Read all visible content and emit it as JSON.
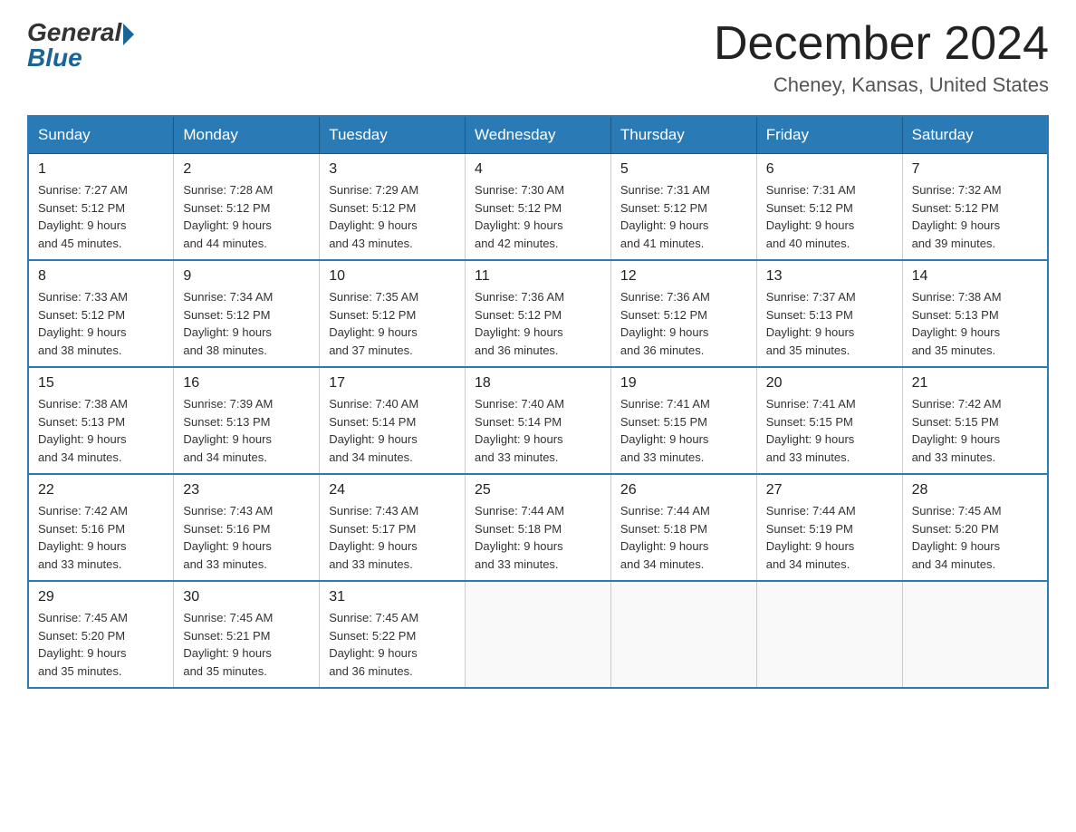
{
  "logo": {
    "general": "General",
    "blue": "Blue"
  },
  "title": {
    "month_year": "December 2024",
    "location": "Cheney, Kansas, United States"
  },
  "days_of_week": [
    "Sunday",
    "Monday",
    "Tuesday",
    "Wednesday",
    "Thursday",
    "Friday",
    "Saturday"
  ],
  "weeks": [
    [
      {
        "day": "1",
        "sunrise": "7:27 AM",
        "sunset": "5:12 PM",
        "daylight": "9 hours and 45 minutes."
      },
      {
        "day": "2",
        "sunrise": "7:28 AM",
        "sunset": "5:12 PM",
        "daylight": "9 hours and 44 minutes."
      },
      {
        "day": "3",
        "sunrise": "7:29 AM",
        "sunset": "5:12 PM",
        "daylight": "9 hours and 43 minutes."
      },
      {
        "day": "4",
        "sunrise": "7:30 AM",
        "sunset": "5:12 PM",
        "daylight": "9 hours and 42 minutes."
      },
      {
        "day": "5",
        "sunrise": "7:31 AM",
        "sunset": "5:12 PM",
        "daylight": "9 hours and 41 minutes."
      },
      {
        "day": "6",
        "sunrise": "7:31 AM",
        "sunset": "5:12 PM",
        "daylight": "9 hours and 40 minutes."
      },
      {
        "day": "7",
        "sunrise": "7:32 AM",
        "sunset": "5:12 PM",
        "daylight": "9 hours and 39 minutes."
      }
    ],
    [
      {
        "day": "8",
        "sunrise": "7:33 AM",
        "sunset": "5:12 PM",
        "daylight": "9 hours and 38 minutes."
      },
      {
        "day": "9",
        "sunrise": "7:34 AM",
        "sunset": "5:12 PM",
        "daylight": "9 hours and 38 minutes."
      },
      {
        "day": "10",
        "sunrise": "7:35 AM",
        "sunset": "5:12 PM",
        "daylight": "9 hours and 37 minutes."
      },
      {
        "day": "11",
        "sunrise": "7:36 AM",
        "sunset": "5:12 PM",
        "daylight": "9 hours and 36 minutes."
      },
      {
        "day": "12",
        "sunrise": "7:36 AM",
        "sunset": "5:12 PM",
        "daylight": "9 hours and 36 minutes."
      },
      {
        "day": "13",
        "sunrise": "7:37 AM",
        "sunset": "5:13 PM",
        "daylight": "9 hours and 35 minutes."
      },
      {
        "day": "14",
        "sunrise": "7:38 AM",
        "sunset": "5:13 PM",
        "daylight": "9 hours and 35 minutes."
      }
    ],
    [
      {
        "day": "15",
        "sunrise": "7:38 AM",
        "sunset": "5:13 PM",
        "daylight": "9 hours and 34 minutes."
      },
      {
        "day": "16",
        "sunrise": "7:39 AM",
        "sunset": "5:13 PM",
        "daylight": "9 hours and 34 minutes."
      },
      {
        "day": "17",
        "sunrise": "7:40 AM",
        "sunset": "5:14 PM",
        "daylight": "9 hours and 34 minutes."
      },
      {
        "day": "18",
        "sunrise": "7:40 AM",
        "sunset": "5:14 PM",
        "daylight": "9 hours and 33 minutes."
      },
      {
        "day": "19",
        "sunrise": "7:41 AM",
        "sunset": "5:15 PM",
        "daylight": "9 hours and 33 minutes."
      },
      {
        "day": "20",
        "sunrise": "7:41 AM",
        "sunset": "5:15 PM",
        "daylight": "9 hours and 33 minutes."
      },
      {
        "day": "21",
        "sunrise": "7:42 AM",
        "sunset": "5:15 PM",
        "daylight": "9 hours and 33 minutes."
      }
    ],
    [
      {
        "day": "22",
        "sunrise": "7:42 AM",
        "sunset": "5:16 PM",
        "daylight": "9 hours and 33 minutes."
      },
      {
        "day": "23",
        "sunrise": "7:43 AM",
        "sunset": "5:16 PM",
        "daylight": "9 hours and 33 minutes."
      },
      {
        "day": "24",
        "sunrise": "7:43 AM",
        "sunset": "5:17 PM",
        "daylight": "9 hours and 33 minutes."
      },
      {
        "day": "25",
        "sunrise": "7:44 AM",
        "sunset": "5:18 PM",
        "daylight": "9 hours and 33 minutes."
      },
      {
        "day": "26",
        "sunrise": "7:44 AM",
        "sunset": "5:18 PM",
        "daylight": "9 hours and 34 minutes."
      },
      {
        "day": "27",
        "sunrise": "7:44 AM",
        "sunset": "5:19 PM",
        "daylight": "9 hours and 34 minutes."
      },
      {
        "day": "28",
        "sunrise": "7:45 AM",
        "sunset": "5:20 PM",
        "daylight": "9 hours and 34 minutes."
      }
    ],
    [
      {
        "day": "29",
        "sunrise": "7:45 AM",
        "sunset": "5:20 PM",
        "daylight": "9 hours and 35 minutes."
      },
      {
        "day": "30",
        "sunrise": "7:45 AM",
        "sunset": "5:21 PM",
        "daylight": "9 hours and 35 minutes."
      },
      {
        "day": "31",
        "sunrise": "7:45 AM",
        "sunset": "5:22 PM",
        "daylight": "9 hours and 36 minutes."
      },
      null,
      null,
      null,
      null
    ]
  ],
  "labels": {
    "sunrise": "Sunrise:",
    "sunset": "Sunset:",
    "daylight": "Daylight:"
  }
}
